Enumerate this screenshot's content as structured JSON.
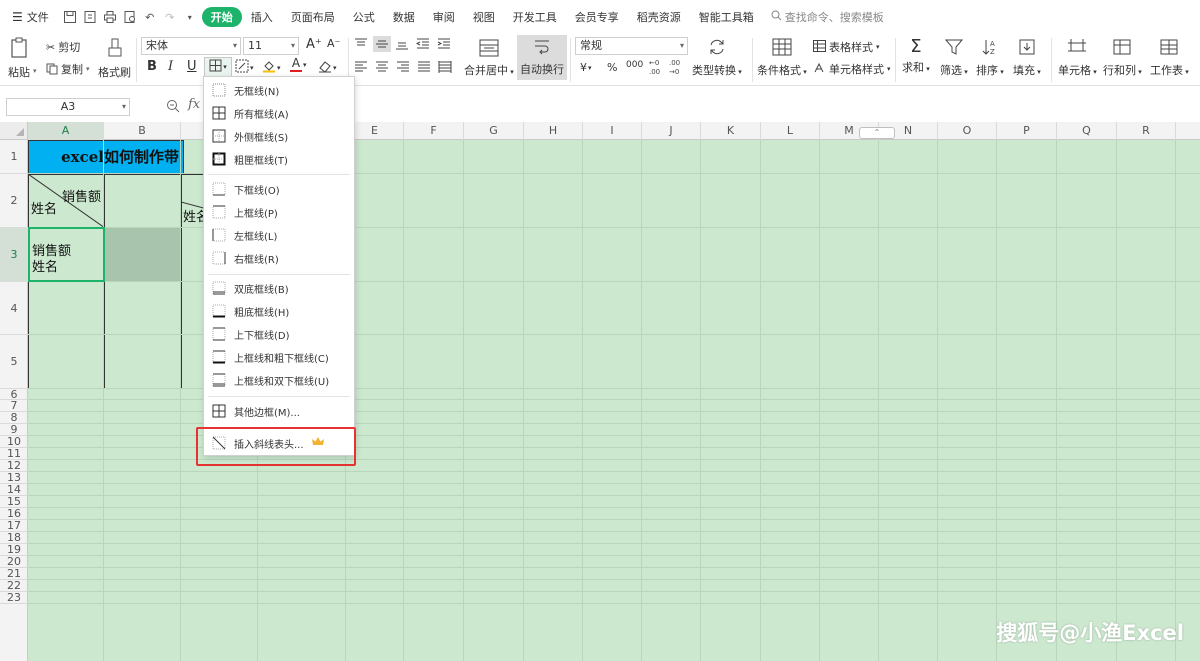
{
  "menubar": {
    "file": "文件",
    "tabs": [
      "开始",
      "插入",
      "页面布局",
      "公式",
      "数据",
      "审阅",
      "视图",
      "开发工具",
      "会员专享",
      "稻壳资源",
      "智能工具箱"
    ],
    "active_tab": "开始",
    "search_placeholder": "查找命令、搜索模板"
  },
  "ribbon": {
    "paste": "粘贴",
    "cut": "剪切",
    "copy": "复制",
    "format_painter": "格式刷",
    "font_name": "宋体",
    "font_size": "11",
    "merge_center": "合并居中",
    "wrap_text": "自动换行",
    "number_format": "常规",
    "type_convert": "类型转换",
    "conditional_format": "条件格式",
    "table_style": "表格样式",
    "cell_style": "单元格样式",
    "sum": "求和",
    "filter": "筛选",
    "sort": "排序",
    "fill": "填充",
    "cell": "单元格",
    "row_col": "行和列",
    "worksheet": "工作表",
    "bold": "B",
    "italic": "I",
    "underline": "U",
    "font_color_glyph": "A",
    "grow_font": "A⁺",
    "shrink_font": "A⁻",
    "percent": "%",
    "thousands": "000",
    "yuan": "¥"
  },
  "formula_bar": {
    "name_box": "A3",
    "fx": "fx"
  },
  "sheet": {
    "columns": [
      "A",
      "B",
      "C",
      "D",
      "E",
      "F",
      "G",
      "H",
      "I",
      "J",
      "K",
      "L",
      "M",
      "N",
      "O",
      "P",
      "Q",
      "R"
    ],
    "rows": [
      "1",
      "2",
      "3",
      "4",
      "5",
      "6",
      "7",
      "8",
      "9",
      "10",
      "11",
      "12",
      "13",
      "14",
      "15",
      "16",
      "17",
      "18",
      "19",
      "20",
      "21",
      "22",
      "23"
    ],
    "selected_column": "A",
    "selected_row": "3",
    "title": "excel如何制作带",
    "b2_top": "销售额",
    "b2_bottom": "姓名",
    "c2_bottom": "姓名",
    "a3_line1": "销售额",
    "a3_line2": "姓名"
  },
  "border_menu": {
    "items": [
      "无框线(N)",
      "所有框线(A)",
      "外侧框线(S)",
      "粗匣框线(T)",
      "下框线(O)",
      "上框线(P)",
      "左框线(L)",
      "右框线(R)",
      "双底框线(B)",
      "粗底框线(H)",
      "上下框线(D)",
      "上框线和粗下框线(C)",
      "上框线和双下框线(U)",
      "其他边框(M)...",
      "插入斜线表头..."
    ]
  },
  "watermark": "搜狐号@小渔Excel",
  "colors": {
    "accent": "#1db36a",
    "sheet_bg": "#cce8cf",
    "title_fill": "#00b0f0",
    "highlight": "#e53333"
  }
}
